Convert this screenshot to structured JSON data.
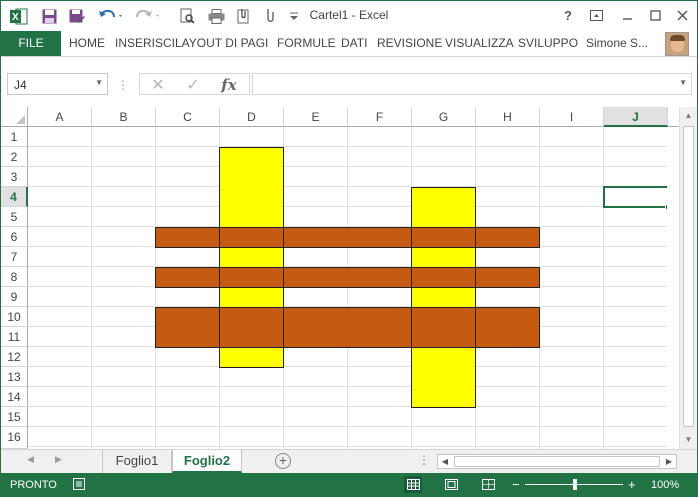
{
  "app": {
    "title": "Cartel1 - Excel",
    "brand_color": "#217346"
  },
  "quick_access": {
    "icons": [
      "excel-logo-icon",
      "save-icon",
      "save-as-icon",
      "undo-icon",
      "redo-icon",
      "print-preview-icon",
      "print-icon",
      "attach-icon",
      "customize-icon"
    ]
  },
  "window_controls": {
    "help": "?",
    "ribbon_display": "ribbon-display-icon",
    "minimize": "minimize-icon",
    "maximize": "maximize-icon",
    "close": "close-icon"
  },
  "ribbon": {
    "tabs": [
      "FILE",
      "HOME",
      "INSERISCI",
      "LAYOUT DI PAGI",
      "FORMULE",
      "DATI",
      "REVISIONE",
      "VISUALIZZA",
      "SVILUPPO"
    ],
    "user": "Simone S..."
  },
  "formula_bar": {
    "name_box": "J4",
    "cancel": "✕",
    "enter": "✓",
    "fx": "fx",
    "value": ""
  },
  "sheet": {
    "columns": [
      "A",
      "B",
      "C",
      "D",
      "E",
      "F",
      "G",
      "H",
      "I",
      "J"
    ],
    "rows": [
      "1",
      "2",
      "3",
      "4",
      "5",
      "6",
      "7",
      "8",
      "9",
      "10",
      "11",
      "12",
      "13",
      "14",
      "15",
      "16"
    ],
    "selected_cell": "J4",
    "selected_column": "J",
    "selected_row": "4",
    "shape_colors": {
      "yellow": "#FFFF00",
      "orange": "#C55A11"
    }
  },
  "sheet_tabs": {
    "tabs": [
      "Foglio1",
      "Foglio2"
    ],
    "active": "Foglio2",
    "add": "⊕"
  },
  "status_bar": {
    "ready": "PRONTO",
    "zoom": "100%",
    "zoom_out": "−",
    "zoom_in": "+"
  }
}
